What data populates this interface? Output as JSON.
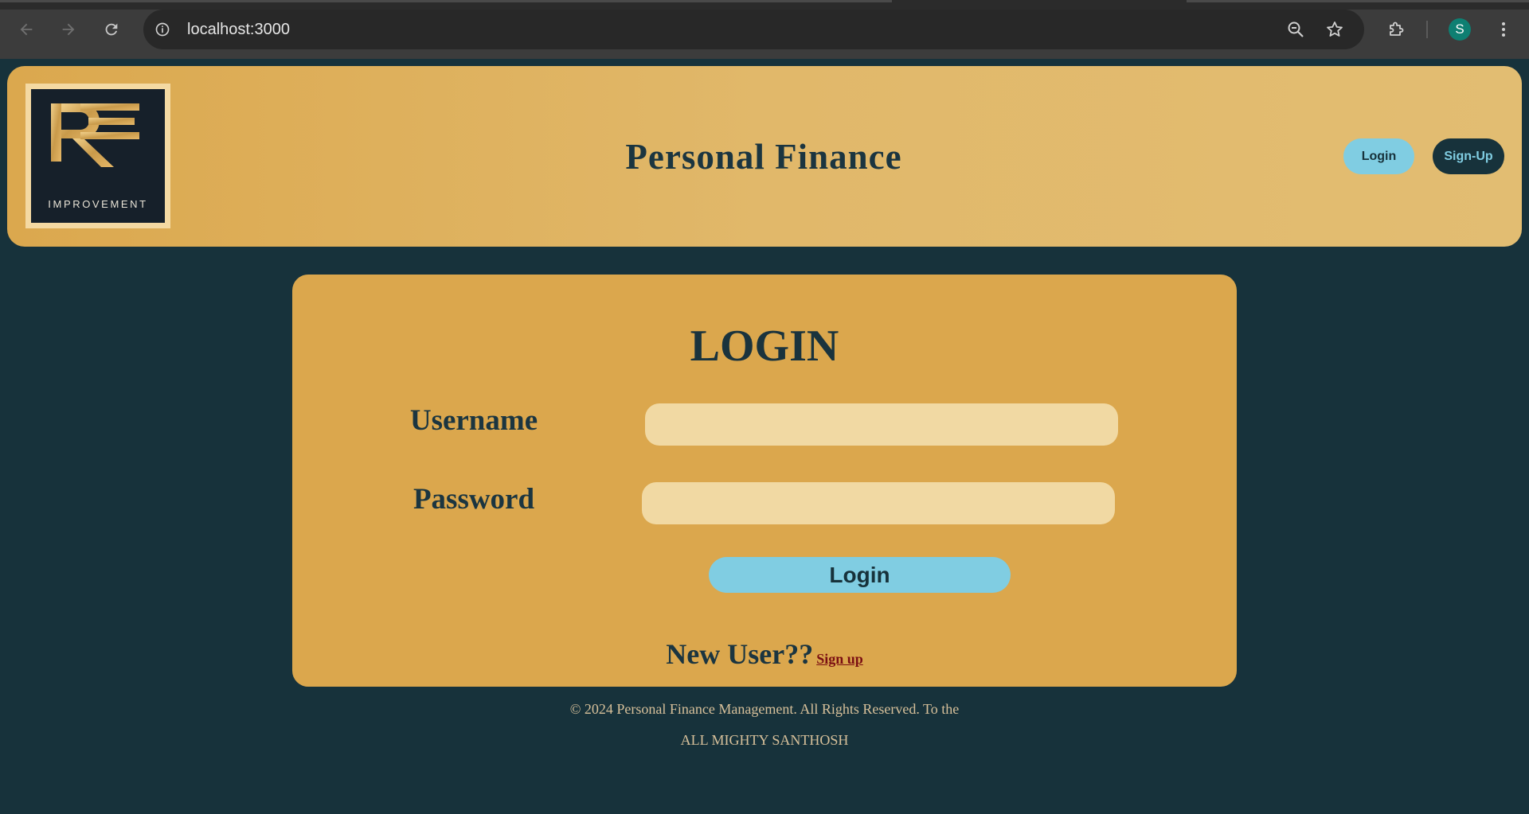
{
  "browser": {
    "url": "localhost:3000",
    "profile_initial": "S",
    "icons": {
      "back": "arrow-left-icon",
      "forward": "arrow-right-icon",
      "reload": "reload-icon",
      "site_info": "info-icon",
      "zoom": "zoom-out-icon",
      "bookmark": "star-icon",
      "extensions": "puzzle-icon",
      "menu": "kebab-menu-icon"
    }
  },
  "header": {
    "logo_text": "IMPROVEMENT",
    "title": "Personal Finance",
    "login_label": "Login",
    "signup_label": "Sign-Up"
  },
  "login_card": {
    "title": "LOGIN",
    "username_label": "Username",
    "username_value": "",
    "password_label": "Password",
    "password_value": "",
    "submit_label": "Login",
    "new_user_text": "New User??",
    "signup_link": "Sign up"
  },
  "footer": {
    "copyright": "© 2024 Personal Finance Management. All Rights Reserved. To the",
    "dedication": "ALL MIGHTY SANTHOSH"
  },
  "colors": {
    "page_background": "#17323b",
    "header_gold": "#dba84e",
    "card_gold": "#dba74d",
    "input_fill": "#f1d9a3",
    "accent_blue": "#80cde2",
    "text_dark": "#1b3540",
    "link_red": "#7a0e12",
    "footer_text": "#d7c09a"
  }
}
